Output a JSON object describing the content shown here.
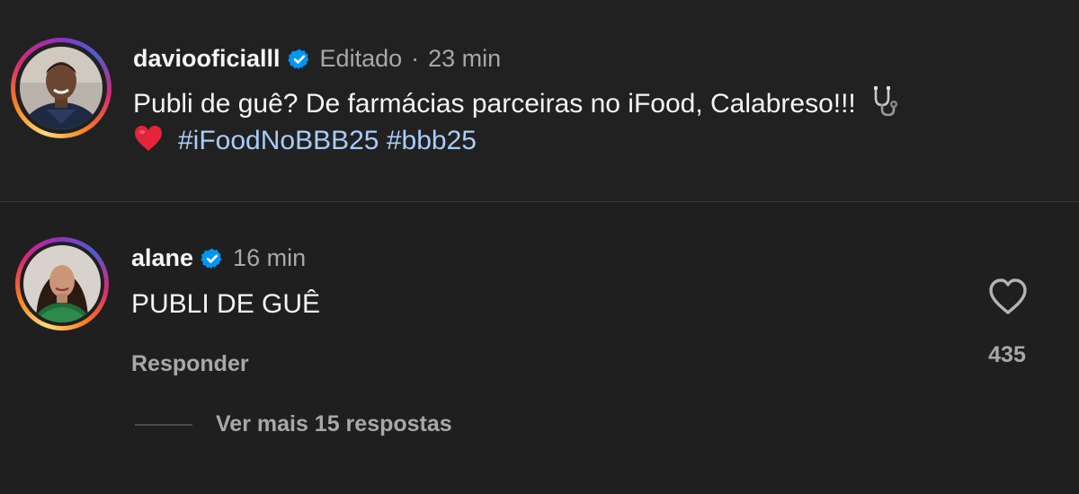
{
  "caption": {
    "username": "daviooficialll",
    "meta_edited": "Editado",
    "meta_separator": "·",
    "meta_time": "23 min",
    "text_line1": "Publi de guê? De farmácias parceiras no iFood, Calabreso!!!",
    "hashtags": [
      "#iFoodNoBBB25",
      "#bbb25"
    ],
    "emojis": [
      "stethoscope",
      "red-heart"
    ]
  },
  "comment": {
    "username": "alane",
    "meta_time": "16 min",
    "text": "PUBLI DE GUÊ",
    "reply_label": "Responder",
    "like_count": "435",
    "view_replies_label": "Ver mais 15 respostas"
  },
  "colors": {
    "background": "#1f1f1f",
    "text": "#f5f5f5",
    "secondary_text": "#a8a8a8",
    "hashtag": "#a9cdfb",
    "verified_badge": "#0095f6"
  }
}
